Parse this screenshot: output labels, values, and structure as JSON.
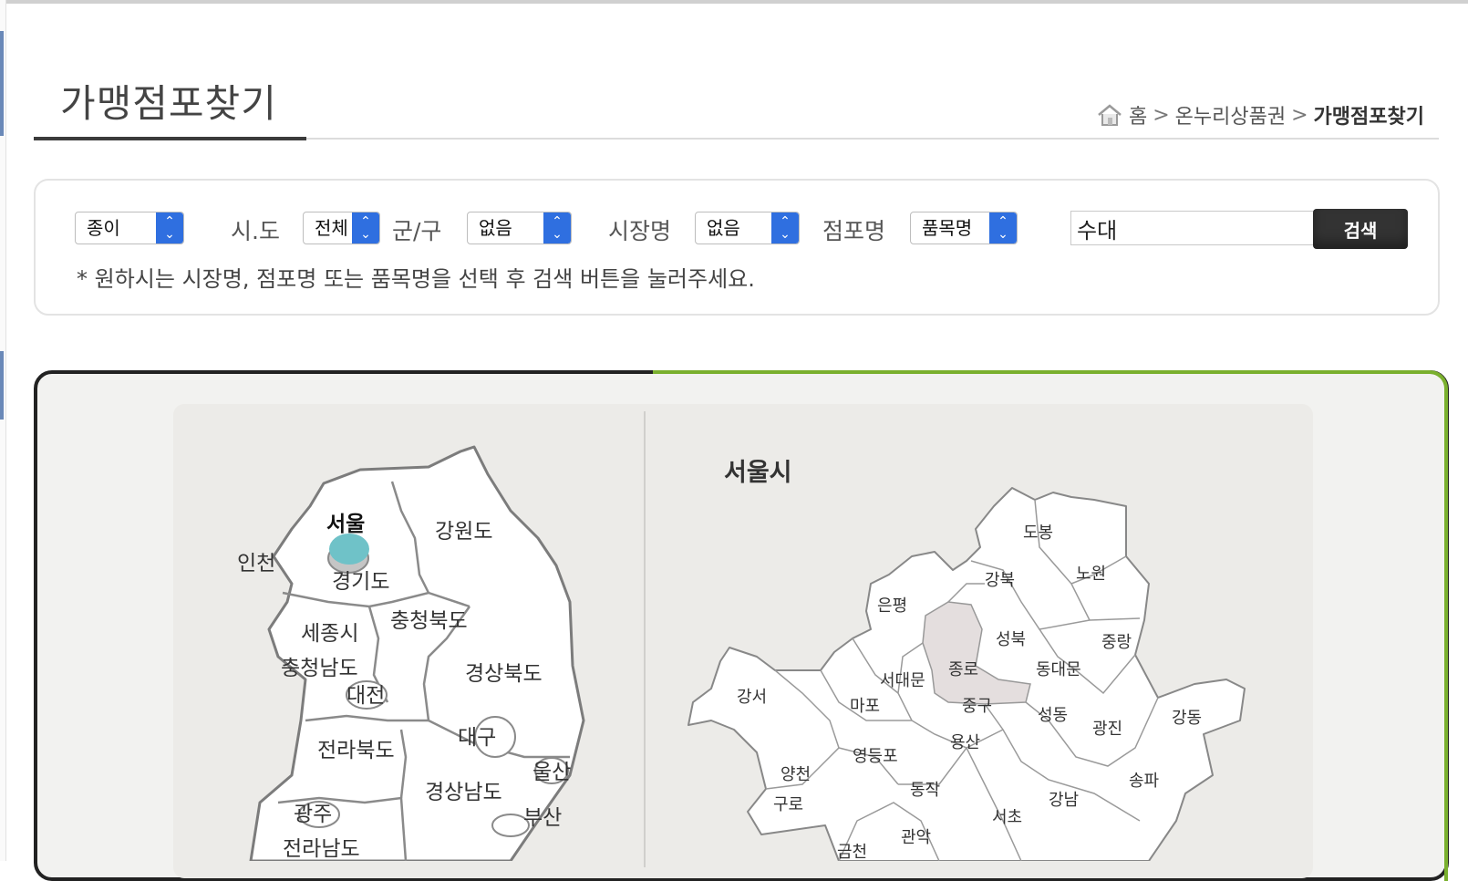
{
  "page": {
    "title": "가맹점포찾기"
  },
  "breadcrumb": {
    "home": "홈",
    "section": "온누리상품권",
    "current": "가맹점포찾기",
    "separator": ">"
  },
  "search": {
    "type_select": "종이",
    "sido_label": "시.도",
    "sido_select": "전체",
    "gugun_label": "군/구",
    "gugun_select": "없음",
    "market_label": "시장명",
    "market_select": "없음",
    "store_label": "점포명",
    "store_select": "품목명",
    "keyword_value": "수대",
    "search_button": "검색",
    "notice": "* 원하시는 시장명, 점포명 또는 품목명을 선택 후 검색 버튼을 눌러주세요."
  },
  "korea_map": {
    "regions": [
      "서울",
      "인천",
      "경기도",
      "강원도",
      "세종시",
      "충청북도",
      "충청남도",
      "대전",
      "경상북도",
      "대구",
      "전라북도",
      "울산",
      "광주",
      "경상남도",
      "부산",
      "전라남도"
    ],
    "selected": "서울",
    "selected_color": "#6fc2c8"
  },
  "seoul_map": {
    "title": "서울시",
    "districts": [
      "도봉",
      "노원",
      "강북",
      "은평",
      "성북",
      "중랑",
      "종로",
      "동대문",
      "서대문",
      "강서",
      "마포",
      "중구",
      "성동",
      "광진",
      "강동",
      "양천",
      "영등포",
      "용산",
      "송파",
      "구로",
      "동작",
      "서초",
      "강남",
      "금천",
      "관악"
    ],
    "selected": "종로",
    "selected_color": "#e4dede"
  }
}
